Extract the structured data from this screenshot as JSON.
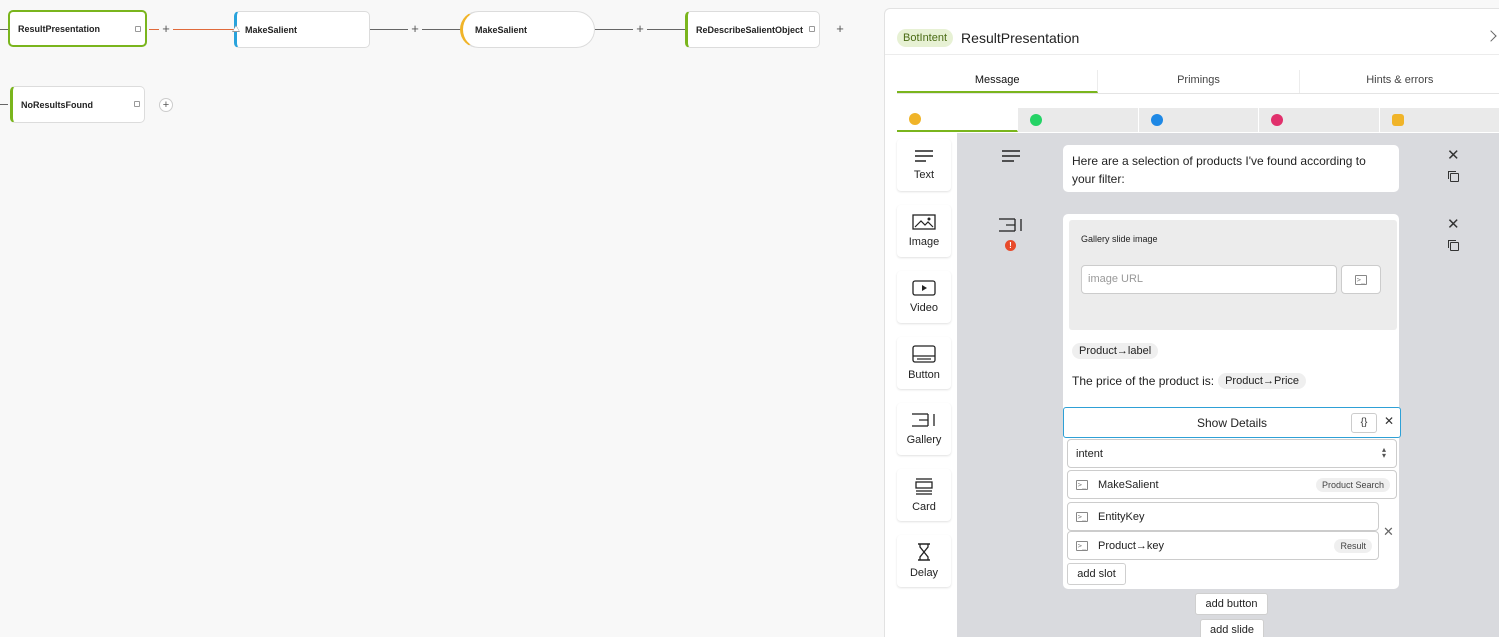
{
  "canvas": {
    "nodes": [
      {
        "label": "ResultPresentation"
      },
      {
        "label": "MakeSalient"
      },
      {
        "label": "MakeSalient"
      },
      {
        "label": "ReDescribeSalientObject"
      },
      {
        "label": "NoResultsFound"
      }
    ],
    "plus": "+"
  },
  "panel": {
    "badge": "BotIntent",
    "title": "ResultPresentation",
    "tabs": [
      "Message",
      "Primings",
      "Hints & errors"
    ],
    "channels": [
      {
        "icon": "webchat-icon",
        "color": "#f0b429"
      },
      {
        "icon": "whatsapp-icon",
        "color": "#25d366"
      },
      {
        "icon": "messenger-icon",
        "color": "#1e88e5"
      },
      {
        "icon": "instagram-icon",
        "color": "#e1306c"
      },
      {
        "icon": "other-channel-icon",
        "color": "#f0b429"
      }
    ],
    "tools": [
      "Text",
      "Image",
      "Video",
      "Button",
      "Gallery",
      "Card",
      "Delay"
    ]
  },
  "editor": {
    "text_message": "Here are a selection of products I've found according to your filter:",
    "gallery": {
      "image_label": "Gallery slide image",
      "image_url_placeholder": "image URL",
      "title_chip": "Product→label",
      "subtitle_prefix": "The price of the product is:",
      "subtitle_chip": "Product→Price",
      "button": {
        "label": "Show Details",
        "curly": "{}",
        "type": "intent",
        "intent_name": "MakeSalient",
        "intent_tag": "Product Search",
        "slots": [
          {
            "name": "EntityKey"
          },
          {
            "value": "Product→key",
            "tag": "Result"
          }
        ],
        "add_slot": "add slot"
      },
      "add_button": "add button",
      "add_slide": "add slide"
    },
    "close": "✕"
  }
}
